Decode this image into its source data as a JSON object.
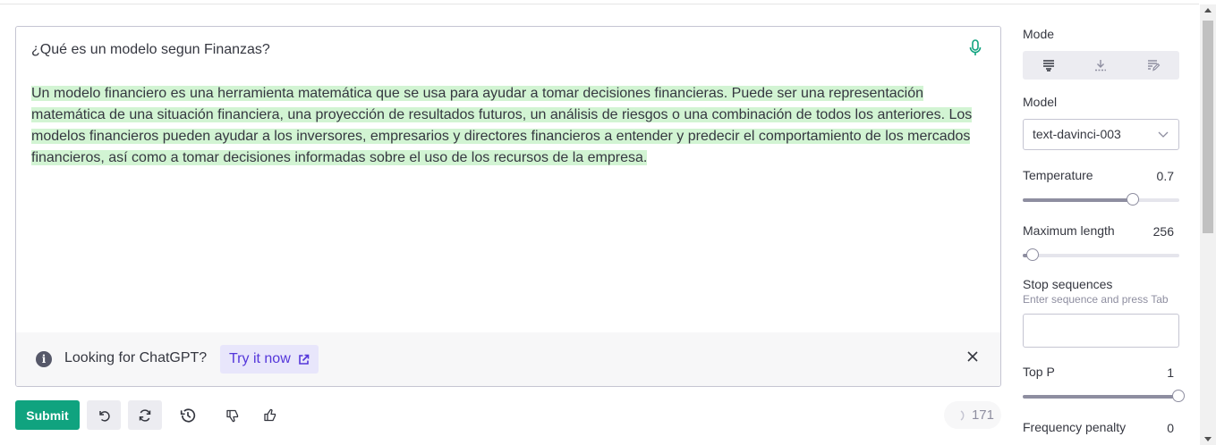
{
  "editor": {
    "prompt": "¿Qué es un modelo segun Finanzas?",
    "completion": "Un modelo financiero es una herramienta matemática que se usa para ayudar a tomar decisiones financieras. Puede ser una representación matemática de una situación financiera, una proyección de resultados futuros, un análisis de riesgos o una combinación de todos los anteriores. Los modelos financieros pueden ayudar a los inversores, empresarios y directores financieros a entender y predecir el comportamiento de los mercados financieros, así como a tomar decisiones informadas sobre el uso de los recursos de la empresa.",
    "highlight_color": "#d2f4d3"
  },
  "banner": {
    "text": "Looking for ChatGPT?",
    "link_label": "Try it now"
  },
  "toolbar": {
    "submit_label": "Submit",
    "token_count": "171"
  },
  "sidebar": {
    "mode_label": "Mode",
    "model_label": "Model",
    "model_value": "text-davinci-003",
    "temperature_label": "Temperature",
    "temperature_value": "0.7",
    "temperature_fraction": 0.7,
    "max_length_label": "Maximum length",
    "max_length_value": "256",
    "max_length_fraction": 0.065,
    "stop_label": "Stop sequences",
    "stop_hint": "Enter sequence and press Tab",
    "top_p_label": "Top P",
    "top_p_value": "1",
    "top_p_fraction": 1.0,
    "freq_label": "Frequency penalty",
    "freq_value": "0"
  },
  "colors": {
    "accent": "#10a37f",
    "link": "#5436da"
  }
}
